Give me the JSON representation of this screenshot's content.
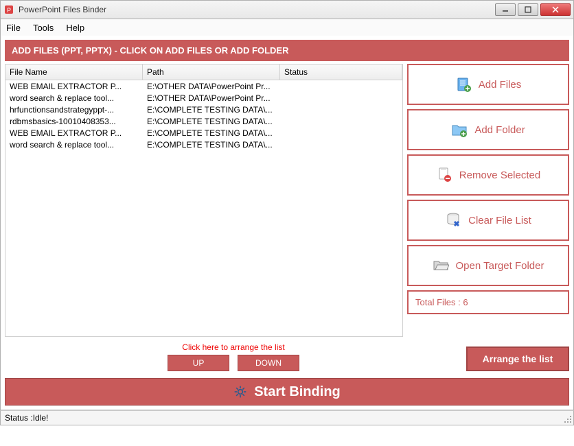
{
  "window": {
    "title": "PowerPoint Files Binder"
  },
  "menu": {
    "file": "File",
    "tools": "Tools",
    "help": "Help"
  },
  "banner": "ADD FILES (PPT, PPTX) - CLICK ON ADD FILES OR ADD FOLDER",
  "columns": {
    "filename": "File Name",
    "path": "Path",
    "status": "Status"
  },
  "rows": [
    {
      "name": "WEB EMAIL EXTRACTOR P...",
      "path": "E:\\OTHER DATA\\PowerPoint Pr...",
      "status": ""
    },
    {
      "name": "word search & replace tool...",
      "path": "E:\\OTHER DATA\\PowerPoint Pr...",
      "status": ""
    },
    {
      "name": "hrfunctionsandstrategyppt-...",
      "path": "E:\\COMPLETE TESTING DATA\\...",
      "status": ""
    },
    {
      "name": "rdbmsbasics-10010408353...",
      "path": "E:\\COMPLETE TESTING DATA\\...",
      "status": ""
    },
    {
      "name": "WEB EMAIL EXTRACTOR P...",
      "path": "E:\\COMPLETE TESTING DATA\\...",
      "status": ""
    },
    {
      "name": "word search & replace tool...",
      "path": "E:\\COMPLETE TESTING DATA\\...",
      "status": ""
    }
  ],
  "side": {
    "addFiles": "Add Files",
    "addFolder": "Add Folder",
    "removeSelected": "Remove Selected",
    "clearList": "Clear File List",
    "openTarget": "Open Target Folder",
    "totalLabel": "Total Files : ",
    "totalCount": "6"
  },
  "arrange": {
    "hint": "Click here to arrange the list",
    "up": "UP",
    "down": "DOWN",
    "button": "Arrange the list"
  },
  "start": "Start Binding",
  "status": {
    "label": "Status  :  ",
    "value": "Idle!"
  }
}
